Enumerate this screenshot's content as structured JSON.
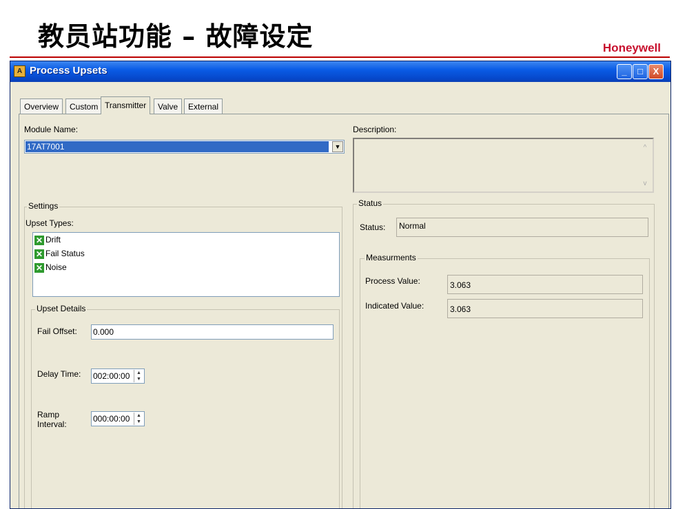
{
  "slide": {
    "title": "教员站功能 – 故障设定",
    "brand": "Honeywell"
  },
  "window": {
    "title": "Process Upsets",
    "controls": {
      "minimize": "_",
      "maximize": "□",
      "close": "X"
    }
  },
  "tabs": [
    {
      "label": "Overview",
      "active": false
    },
    {
      "label": "Custom",
      "active": false
    },
    {
      "label": "Transmitter",
      "active": true
    },
    {
      "label": "Valve",
      "active": false
    },
    {
      "label": "External",
      "active": false
    }
  ],
  "module": {
    "label": "Module Name:",
    "value": "17AT7001"
  },
  "description": {
    "label": "Description:",
    "value": ""
  },
  "settings": {
    "title": "Settings",
    "upset_types_label": "Upset Types:",
    "upset_types": [
      {
        "label": "Drift",
        "checked": true
      },
      {
        "label": "Fail Status",
        "checked": true
      },
      {
        "label": "Noise",
        "checked": true
      }
    ],
    "upset_details": {
      "title": "Upset Details",
      "fail_offset_label": "Fail Offset:",
      "fail_offset_value": "0.000",
      "delay_time_label": "Delay Time:",
      "delay_time_value": "002:00:00",
      "ramp_interval_label_1": "Ramp",
      "ramp_interval_label_2": "Interval:",
      "ramp_interval_value": "000:00:00"
    }
  },
  "status": {
    "title": "Status",
    "status_label": "Status:",
    "status_value": "Normal",
    "measurements": {
      "title": "Measurments",
      "process_value_label": "Process Value:",
      "process_value": "3.063",
      "indicated_value_label": "Indicated Value:",
      "indicated_value": "3.063"
    }
  },
  "colors": {
    "titlebar": "#0a5ce6",
    "brand": "#c8102e",
    "selection": "#316ac5",
    "check": "#2e9a2e"
  }
}
